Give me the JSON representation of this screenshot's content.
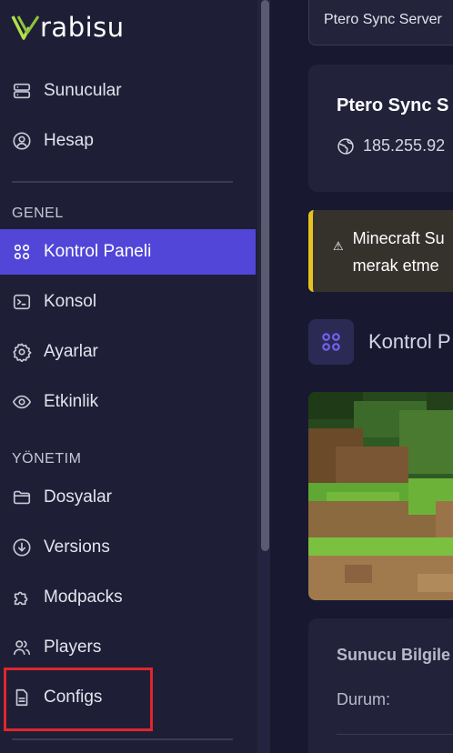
{
  "brand": {
    "logo_text": "rabisu"
  },
  "sidebar": {
    "top_items": [
      {
        "label": "Sunucular",
        "icon": "server-icon"
      },
      {
        "label": "Hesap",
        "icon": "user-circle-icon"
      }
    ],
    "sections": [
      {
        "title": "GENEL",
        "items": [
          {
            "label": "Kontrol Paneli",
            "icon": "dashboard-icon",
            "active": true
          },
          {
            "label": "Konsol",
            "icon": "terminal-icon"
          },
          {
            "label": "Ayarlar",
            "icon": "gear-icon"
          },
          {
            "label": "Etkinlik",
            "icon": "eye-icon"
          }
        ]
      },
      {
        "title": "YÖNETIM",
        "items": [
          {
            "label": "Dosyalar",
            "icon": "folder-icon"
          },
          {
            "label": "Versions",
            "icon": "download-circle-icon"
          },
          {
            "label": "Modpacks",
            "icon": "puzzle-icon"
          },
          {
            "label": "Players",
            "icon": "users-icon"
          },
          {
            "label": "Configs",
            "icon": "file-icon"
          }
        ]
      }
    ],
    "highlighted_item": "Configs"
  },
  "main": {
    "top_chip": "Ptero Sync Server",
    "server_card": {
      "name": "Ptero Sync S",
      "ip": "185.255.92"
    },
    "warning": {
      "lines": [
        "Minecraft Su",
        "merak etme"
      ]
    },
    "panel_title": "Kontrol P",
    "info_card": {
      "title": "Sunucu Bilgile",
      "status_label": "Durum:"
    }
  },
  "colors": {
    "sidebar_bg": "#1e1e36",
    "active_bg": "#5146d8",
    "warning_accent": "#e6c21e",
    "highlight_border": "#e0262b",
    "logo_accent": "#b5e04a"
  }
}
